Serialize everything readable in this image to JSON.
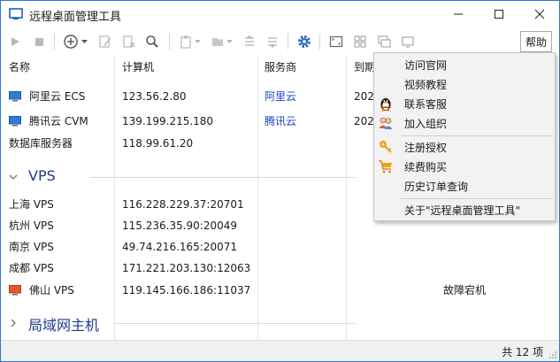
{
  "window": {
    "title": "远程桌面管理工具",
    "help_label": "帮助"
  },
  "toolbar": {
    "icons": [
      "play-icon",
      "stop-icon",
      "add-icon",
      "dropdown-icon",
      "edit-icon",
      "delete-icon",
      "search-icon",
      "clipboard-icon",
      "dropdown-icon",
      "folder-icon",
      "dropdown-icon",
      "collapse-icon",
      "expand-icon",
      "gear-icon",
      "fullscreen-icon",
      "tile-icon",
      "cascade-icon",
      "window-icon"
    ]
  },
  "columns": [
    {
      "label": "名称"
    },
    {
      "label": "计算机"
    },
    {
      "label": "服务商"
    },
    {
      "label": "到期"
    }
  ],
  "rows_top": [
    {
      "name": "阿里云 ECS",
      "host": "123.56.2.80",
      "provider": "阿里云",
      "expire": "202",
      "icon": "monitor-icon"
    },
    {
      "name": "腾讯云 CVM",
      "host": "139.199.215.180",
      "provider": "腾讯云",
      "expire": "202",
      "icon": "monitor-icon"
    },
    {
      "name": "数据库服务器",
      "host": "118.99.61.20",
      "provider": "",
      "expire": "",
      "icon": ""
    }
  ],
  "groups": {
    "vps": "VPS",
    "lan": "局域网主机"
  },
  "rows_vps": [
    {
      "name": "上海 VPS",
      "host": "116.228.229.37:20701",
      "note": ""
    },
    {
      "name": "杭州 VPS",
      "host": "115.236.35.90:20049",
      "note": ""
    },
    {
      "name": "南京 VPS",
      "host": "49.74.216.165:20071",
      "note": ""
    },
    {
      "name": "成都 VPS",
      "host": "171.221.203.130:12063",
      "note": ""
    },
    {
      "name": "佛山 VPS",
      "host": "119.145.166.186:11037",
      "note": "故障宕机"
    }
  ],
  "menu": {
    "items": [
      {
        "label": "访问官网",
        "icon": ""
      },
      {
        "label": "视频教程",
        "icon": ""
      },
      {
        "label": "联系客服",
        "icon": "qq-penguin-icon"
      },
      {
        "label": "加入组织",
        "icon": "group-users-icon"
      },
      {
        "label": "注册授权",
        "icon": "key-icon"
      },
      {
        "label": "续费购买",
        "icon": "shopping-cart-icon"
      },
      {
        "label": "历史订单查询",
        "icon": ""
      },
      {
        "label": "关于\"远程桌面管理工具\"",
        "icon": ""
      }
    ]
  },
  "status": {
    "count": "共 12 项"
  },
  "colors": {
    "link": "#1a45c6",
    "group_label": "#1e3a8a",
    "monitor_blue": "#2f7bd9",
    "monitor_red": "#e8542c"
  }
}
